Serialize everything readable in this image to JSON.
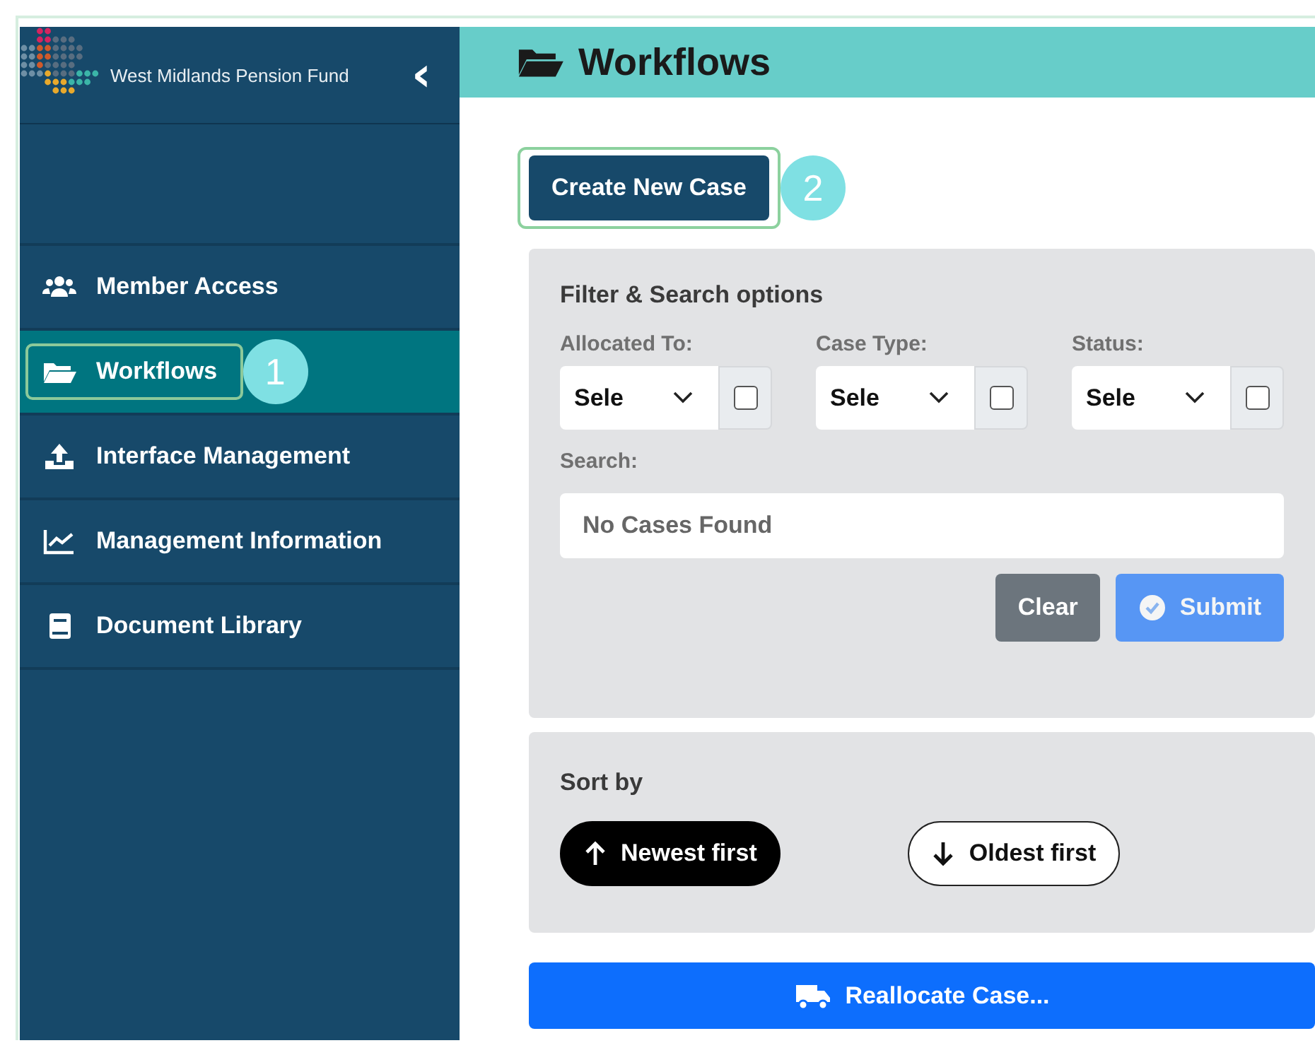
{
  "sidebar": {
    "brand": "West Midlands Pension Fund",
    "collapse_icon": "‹",
    "items": [
      {
        "label": "Member Access",
        "kind": "users",
        "selected": false
      },
      {
        "label": "Workflows",
        "kind": "folder",
        "selected": true,
        "callout": "1"
      },
      {
        "label": "Interface Management",
        "kind": "upload",
        "selected": false
      },
      {
        "label": "Management Information",
        "kind": "chart",
        "selected": false
      },
      {
        "label": "Document Library",
        "kind": "book",
        "selected": false
      }
    ]
  },
  "header": {
    "title": "Workflows"
  },
  "create_button": {
    "label": "Create New Case",
    "callout": "2"
  },
  "filter": {
    "title": "Filter & Search options",
    "selects": [
      {
        "label": "Allocated To:",
        "value": "Sele",
        "checked": false
      },
      {
        "label": "Case Type:",
        "value": "Sele",
        "checked": false
      },
      {
        "label": "Status:",
        "value": "Sele",
        "checked": false
      }
    ],
    "search_label": "Search:",
    "search_value": "No Cases Found",
    "buttons": [
      {
        "label": "Clear",
        "kind": "clear",
        "disabled": false
      },
      {
        "label": "Submit",
        "kind": "submit",
        "disabled": true
      }
    ]
  },
  "sort": {
    "title": "Sort by",
    "options": [
      {
        "label": "Newest first",
        "selected": true
      },
      {
        "label": "Oldest first",
        "selected": false
      }
    ]
  },
  "reallocate_button": {
    "label": "Reallocate Case..."
  }
}
